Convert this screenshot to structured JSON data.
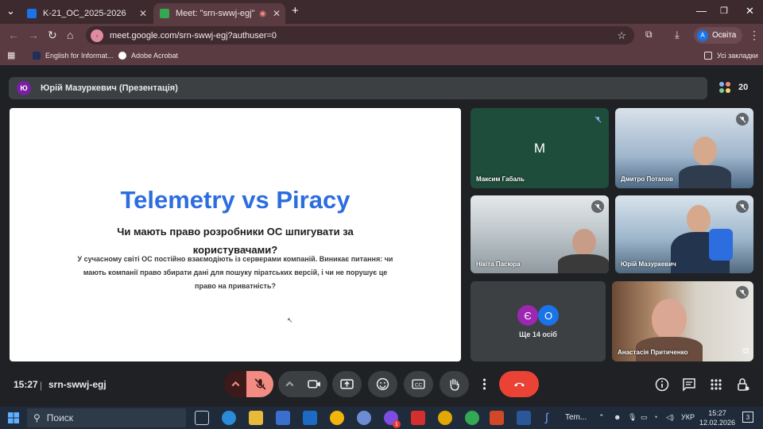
{
  "browser": {
    "tabs": [
      {
        "label": "K-21_ОС_2025-2026",
        "active": false
      },
      {
        "label": "Meet: \"srn-swwj-egj\"",
        "active": true
      }
    ],
    "new_tab": "+",
    "address": "meet.google.com/srn-swwj-egj?authuser=0",
    "profile": {
      "initial": "A",
      "label": "Освіта"
    },
    "bookmarks": [
      {
        "label": "English for Informat...",
        "color": "#1f2f58"
      },
      {
        "label": "Adobe Acrobat",
        "color": "#ffffff"
      }
    ],
    "all_bookmarks": "Усі закладки"
  },
  "meet": {
    "presenter": {
      "initial": "Ю",
      "label": "Юрій Мазуркевич (Презентація)"
    },
    "participants_count": "20",
    "slide": {
      "title": "Telemetry vs Piracy",
      "subtitle": "Чи мають право розробники ОС шпигувати за користувачами?",
      "body": "У сучасному світі ОС постійно взаємодіють із серверами компаній. Виникає питання: чи мають компанії право збирати дані для пошуку піратських версій, і чи не порушує це право на приватність?"
    },
    "tiles": [
      {
        "name": "Максим Габаль",
        "initial": "M",
        "type": "avatar"
      },
      {
        "name": "Дмитро Потапов",
        "type": "camera"
      },
      {
        "name": "Нікіта Пасюра",
        "type": "camera"
      },
      {
        "name": "Юрій Мазуркевич",
        "type": "camera"
      },
      {
        "name": "Ще 14 осіб",
        "type": "more",
        "avatars": [
          "Є",
          "О"
        ]
      },
      {
        "name": "Анастасія Притиченко",
        "type": "camera"
      }
    ],
    "time": "15:27",
    "separator": "|",
    "meeting_code": "srn-swwj-egj"
  },
  "taskbar": {
    "search_placeholder": "Поиск",
    "app_label": "Tem...",
    "language": "УКР",
    "clock_time": "15:27",
    "clock_date": "12.02.2026",
    "notifications": "3",
    "mail_badge": "1"
  },
  "colors": {
    "accent": "#2c6de0",
    "end_call": "#ea4335",
    "browser_frame": "#5a3b42"
  }
}
